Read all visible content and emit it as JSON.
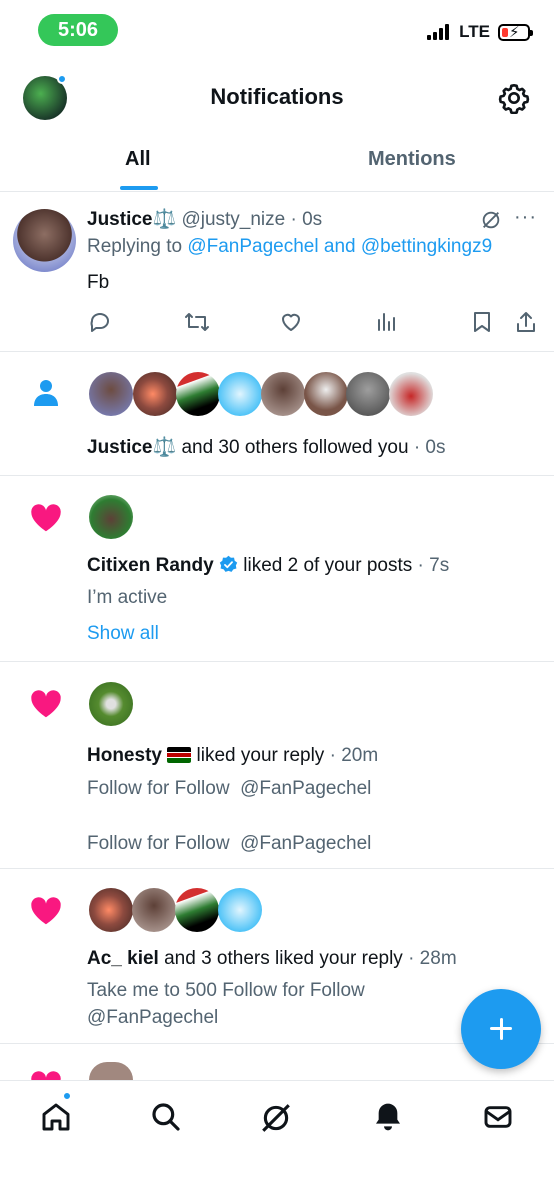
{
  "status_bar": {
    "time": "5:06",
    "network": "LTE"
  },
  "header": {
    "title": "Notifications"
  },
  "tabs": [
    {
      "label": "All"
    },
    {
      "label": "Mentions"
    }
  ],
  "reply": {
    "name": "Justice",
    "handle": "@justy_nize",
    "time": "· 0s",
    "replying_prefix": "Replying to",
    "mention1": "@FanPagechel",
    "and": "and",
    "mention2": "@bettingkingz9",
    "body": "Fb",
    "more": "···"
  },
  "follow_notif": {
    "name": "Justice",
    "text": "and 30 others followed you",
    "time": "· 0s"
  },
  "like1": {
    "name": "Citixen Randy",
    "text": "liked 2 of your posts",
    "time": "· 7s",
    "post": "I’m active",
    "show_all": "Show all"
  },
  "like2": {
    "name": "Honesty",
    "text": "liked your reply",
    "time": "· 20m",
    "line1": "Follow for Follow  @FanPagechel",
    "line2": "Follow for Follow  @FanPagechel"
  },
  "like3": {
    "name": "Ac_ kiel",
    "text": "and 3 others liked your reply",
    "time": "· 28m",
    "line1": "Take me to 500 Follow for Follow",
    "line2": "@FanPagechel"
  },
  "icons": [
    "gear-icon",
    "reply-icon",
    "retweet-icon",
    "like-icon",
    "views-icon",
    "bookmark-icon",
    "share-icon",
    "person-icon",
    "heart-icon",
    "home-icon",
    "search-icon",
    "grok-icon",
    "bell-icon",
    "mail-icon",
    "compose-icon"
  ],
  "colors": {
    "accent": "#1d9bf0",
    "heart": "#f91880",
    "muted": "#536471",
    "status_green": "#34c759"
  }
}
